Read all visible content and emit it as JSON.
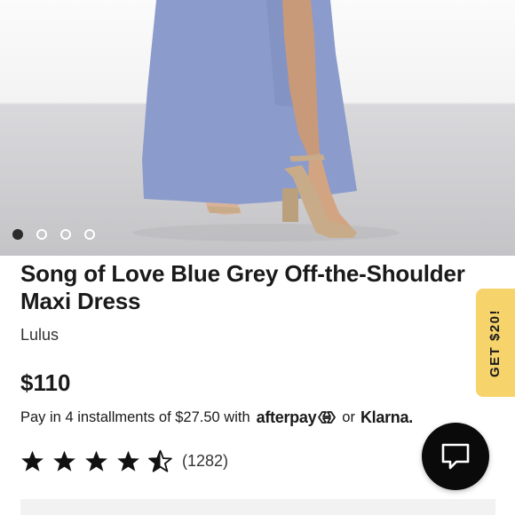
{
  "gallery": {
    "dots": [
      {
        "active": true
      },
      {
        "active": false
      },
      {
        "active": false
      },
      {
        "active": false
      }
    ]
  },
  "product": {
    "title": "Song of Love Blue Grey Off-the-Shoulder Maxi Dress",
    "brand": "Lulus",
    "price": "$110"
  },
  "installments": {
    "text": "Pay in 4 installments of $27.50 with",
    "afterpay_label": "afterpay",
    "or_label": "or",
    "klarna_label": "Klarna."
  },
  "rating": {
    "stars": 4.5,
    "count_label": "(1282)"
  },
  "promo": {
    "label": "GET $20!"
  },
  "chat": {
    "icon": "chat-bubble-icon"
  },
  "colors": {
    "dress": "#8b9bcc",
    "promo_bg": "#f7d36b",
    "chat_bg": "#0a0a0a"
  }
}
